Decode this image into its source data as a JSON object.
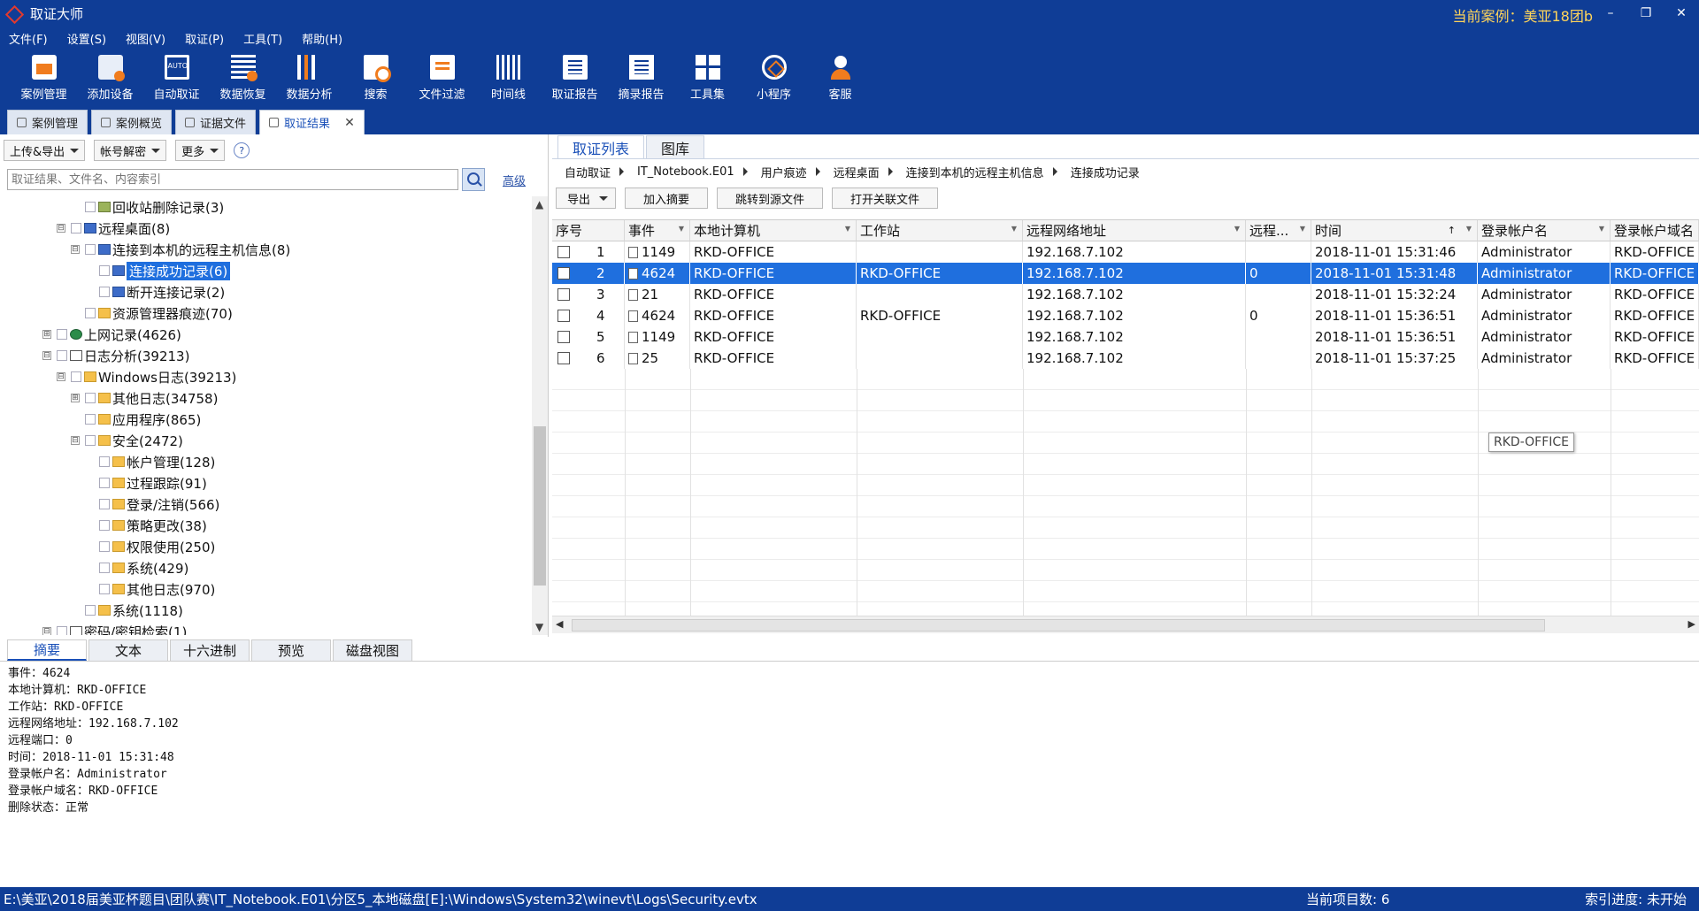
{
  "app": {
    "title": "取证大师",
    "current_case": "当前案例：美亚18团b"
  },
  "window_controls": [
    "–",
    "❐",
    "✕"
  ],
  "menu": [
    "文件(F)",
    "设置(S)",
    "视图(V)",
    "取证(P)",
    "工具(T)",
    "帮助(H)"
  ],
  "toolbar": [
    {
      "label": "案例管理",
      "icon": "case-manage-icon"
    },
    {
      "label": "添加设备",
      "icon": "add-device-icon"
    },
    {
      "label": "自动取证",
      "icon": "auto-forensics-icon"
    },
    {
      "label": "数据恢复",
      "icon": "data-recovery-icon"
    },
    {
      "label": "数据分析",
      "icon": "data-analysis-icon"
    },
    {
      "label": "搜索",
      "icon": "search-doc-icon"
    },
    {
      "label": "文件过滤",
      "icon": "file-filter-icon"
    },
    {
      "label": "时间线",
      "icon": "timeline-icon"
    },
    {
      "label": "取证报告",
      "icon": "forensic-report-icon"
    },
    {
      "label": "摘录报告",
      "icon": "excerpt-report-icon"
    },
    {
      "label": "工具集",
      "icon": "toolset-icon"
    },
    {
      "label": "小程序",
      "icon": "mini-program-icon"
    },
    {
      "label": "客服",
      "icon": "customer-service-icon"
    }
  ],
  "doc_tabs": [
    {
      "label": "案例管理",
      "active": false
    },
    {
      "label": "案例概览",
      "active": false
    },
    {
      "label": "证据文件",
      "active": false
    },
    {
      "label": "取证结果",
      "active": true,
      "close": "✕"
    }
  ],
  "left_panel": {
    "buttons": [
      "上传&导出",
      "帐号解密",
      "更多"
    ],
    "help": "?",
    "search_placeholder": "取证结果、文件名、内容索引",
    "advanced": "高级",
    "tree": [
      {
        "label": "回收站删除记录(3)",
        "level": 3,
        "exp": "",
        "icon": "bin",
        "selected": false
      },
      {
        "label": "远程桌面(8)",
        "level": 2,
        "exp": "⊟",
        "icon": "blue",
        "selected": false
      },
      {
        "label": "连接到本机的远程主机信息(8)",
        "level": 3,
        "exp": "⊟",
        "icon": "blue",
        "selected": false
      },
      {
        "label": "连接成功记录(6)",
        "level": 4,
        "exp": "",
        "icon": "blue",
        "selected": true
      },
      {
        "label": "断开连接记录(2)",
        "level": 4,
        "exp": "",
        "icon": "blue",
        "selected": false
      },
      {
        "label": "资源管理器痕迹(70)",
        "level": 3,
        "exp": "",
        "icon": "folder",
        "selected": false
      },
      {
        "label": "上网记录(4626)",
        "level": 1,
        "exp": "⊞",
        "icon": "globe",
        "selected": false
      },
      {
        "label": "日志分析(39213)",
        "level": 1,
        "exp": "⊟",
        "icon": "log",
        "selected": false
      },
      {
        "label": "Windows日志(39213)",
        "level": 2,
        "exp": "⊟",
        "icon": "folder",
        "selected": false
      },
      {
        "label": "其他日志(34758)",
        "level": 3,
        "exp": "⊞",
        "icon": "folder",
        "selected": false
      },
      {
        "label": "应用程序(865)",
        "level": 3,
        "exp": "",
        "icon": "folder",
        "selected": false
      },
      {
        "label": "安全(2472)",
        "level": 3,
        "exp": "⊟",
        "icon": "folder",
        "selected": false
      },
      {
        "label": "帐户管理(128)",
        "level": 4,
        "exp": "",
        "icon": "folder",
        "selected": false
      },
      {
        "label": "过程跟踪(91)",
        "level": 4,
        "exp": "",
        "icon": "folder",
        "selected": false
      },
      {
        "label": "登录/注销(566)",
        "level": 4,
        "exp": "",
        "icon": "folder",
        "selected": false
      },
      {
        "label": "策略更改(38)",
        "level": 4,
        "exp": "",
        "icon": "folder",
        "selected": false
      },
      {
        "label": "权限使用(250)",
        "level": 4,
        "exp": "",
        "icon": "folder",
        "selected": false
      },
      {
        "label": "系统(429)",
        "level": 4,
        "exp": "",
        "icon": "folder",
        "selected": false
      },
      {
        "label": "其他日志(970)",
        "level": 4,
        "exp": "",
        "icon": "folder",
        "selected": false
      },
      {
        "label": "系统(1118)",
        "level": 3,
        "exp": "",
        "icon": "folder",
        "selected": false
      },
      {
        "label": "密码/密钥检索(1)",
        "level": 1,
        "exp": "⊟",
        "icon": "log",
        "selected": false
      }
    ]
  },
  "right_panel": {
    "tabs": [
      {
        "label": "取证列表",
        "active": true
      },
      {
        "label": "图库",
        "active": false
      }
    ],
    "breadcrumb": [
      "自动取证",
      "IT_Notebook.E01",
      "用户痕迹",
      "远程桌面",
      "连接到本机的远程主机信息",
      "连接成功记录"
    ],
    "buttons": [
      "导出",
      "加入摘要",
      "跳转到源文件",
      "打开关联文件"
    ],
    "columns": [
      "序号",
      "事件",
      "本地计算机",
      "工作站",
      "远程网络地址",
      "远程...",
      "时间",
      "登录帐户名",
      "登录帐户域名"
    ],
    "sort_indicator": "↑",
    "rows": [
      {
        "no": "1",
        "event": "1149",
        "local": "RKD-OFFICE",
        "ws": "",
        "addr": "192.168.7.102",
        "port": "",
        "time": "2018-11-01 15:31:46",
        "user": "Administrator",
        "domain": "RKD-OFFICE",
        "selected": false
      },
      {
        "no": "2",
        "event": "4624",
        "local": "RKD-OFFICE",
        "ws": "RKD-OFFICE",
        "addr": "192.168.7.102",
        "port": "0",
        "time": "2018-11-01 15:31:48",
        "user": "Administrator",
        "domain": "RKD-OFFICE",
        "selected": true
      },
      {
        "no": "3",
        "event": "21",
        "local": "RKD-OFFICE",
        "ws": "",
        "addr": "192.168.7.102",
        "port": "",
        "time": "2018-11-01 15:32:24",
        "user": "Administrator",
        "domain": "RKD-OFFICE",
        "selected": false
      },
      {
        "no": "4",
        "event": "4624",
        "local": "RKD-OFFICE",
        "ws": "RKD-OFFICE",
        "addr": "192.168.7.102",
        "port": "0",
        "time": "2018-11-01 15:36:51",
        "user": "Administrator",
        "domain": "RKD-OFFICE",
        "selected": false
      },
      {
        "no": "5",
        "event": "1149",
        "local": "RKD-OFFICE",
        "ws": "",
        "addr": "192.168.7.102",
        "port": "",
        "time": "2018-11-01 15:36:51",
        "user": "Administrator",
        "domain": "RKD-OFFICE",
        "selected": false
      },
      {
        "no": "6",
        "event": "25",
        "local": "RKD-OFFICE",
        "ws": "",
        "addr": "192.168.7.102",
        "port": "",
        "time": "2018-11-01 15:37:25",
        "user": "Administrator",
        "domain": "RKD-OFFICE",
        "selected": false
      }
    ],
    "tooltip": "RKD-OFFICE"
  },
  "bottom_panel": {
    "tabs": [
      {
        "label": "摘要",
        "active": true
      },
      {
        "label": "文本",
        "active": false
      },
      {
        "label": "十六进制",
        "active": false
      },
      {
        "label": "预览",
        "active": false
      },
      {
        "label": "磁盘视图",
        "active": false
      }
    ],
    "details": [
      "事件：4624",
      "本地计算机：RKD-OFFICE",
      "工作站：RKD-OFFICE",
      "远程网络地址：192.168.7.102",
      "远程端口：0",
      "时间：2018-11-01 15:31:48",
      "登录帐户名：Administrator",
      "登录帐户域名：RKD-OFFICE",
      "删除状态：正常"
    ]
  },
  "statusbar": {
    "path": "E:\\美亚\\2018届美亚杯题目\\团队赛\\IT_Notebook.E01\\分区5_本地磁盘[E]:\\Windows\\System32\\winevt\\Logs\\Security.evtx",
    "count": "当前项目数: 6",
    "progress": "索引进度: 未开始"
  },
  "colors": {
    "chrome_blue": "#0f3d96",
    "selection_blue": "#1f6fde",
    "accent_orange": "#f07c1e",
    "case_yellow": "#ffd45a"
  }
}
